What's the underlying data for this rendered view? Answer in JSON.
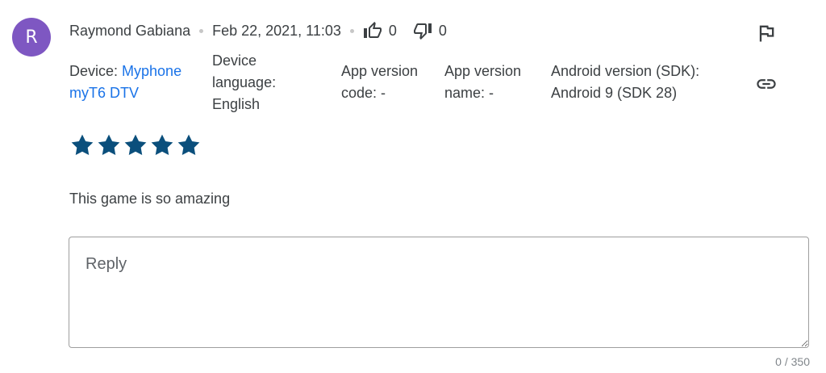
{
  "review": {
    "avatar_initial": "R",
    "avatar_color": "#7e57c2",
    "author": "Raymond Gabiana",
    "date": "Feb 22, 2021, 11:03",
    "thumbs_up_count": "0",
    "thumbs_down_count": "0",
    "rating": 5,
    "rating_max": 5,
    "star_color": "#0b4f7c",
    "text": "This game is so amazing"
  },
  "meta": {
    "device": {
      "label": "Device: ",
      "value_line1": "Myphone",
      "value_line2": "myT6 DTV"
    },
    "device_language": {
      "line1": "Device",
      "line2": "language:",
      "line3": "English"
    },
    "app_version_code": {
      "line1": "App version",
      "line2": "code: -"
    },
    "app_version_name": {
      "line1": "App version",
      "line2": "name: -"
    },
    "android_version": {
      "line1": "Android version (SDK):",
      "line2": "Android 9 (SDK 28)"
    }
  },
  "actions": {
    "flag_icon": "flag-icon",
    "link_icon": "link-icon"
  },
  "reply": {
    "placeholder": "Reply",
    "counter": "0 / 350"
  },
  "colors": {
    "link": "#1a73e8",
    "text": "#3c4043"
  }
}
